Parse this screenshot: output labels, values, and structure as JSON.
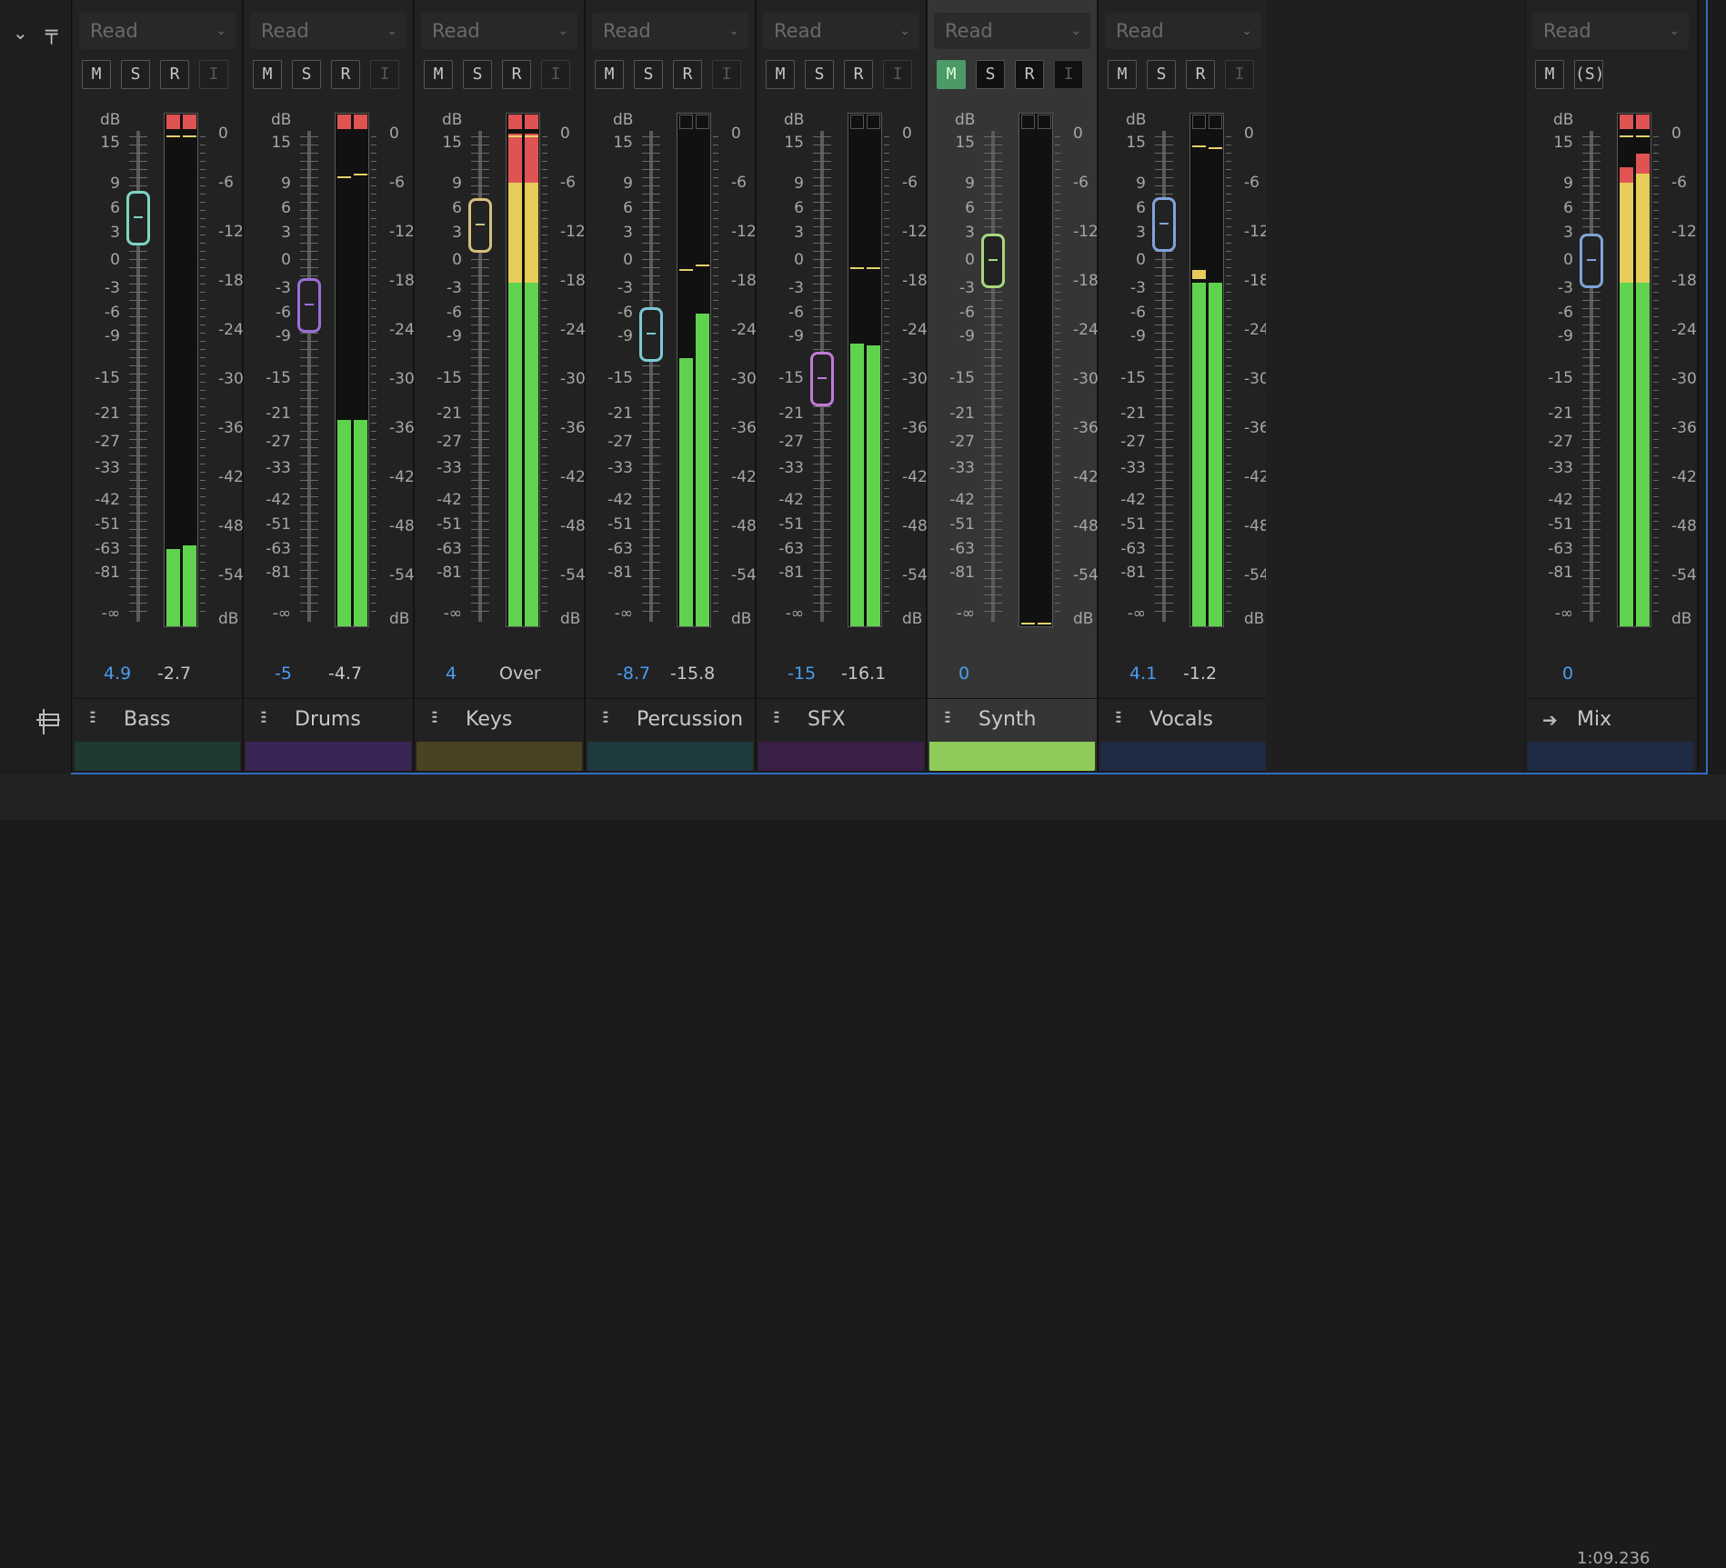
{
  "left_panel": {
    "collapse_icon": "chevron-down-icon",
    "pin_icon": "pin-icon",
    "track_icon": "track-targeting-icon"
  },
  "mode_label": "Read",
  "scale": {
    "fader_top": "dB",
    "fader_ticks": [
      "15",
      "9",
      "6",
      "3",
      "0",
      "-3",
      "-6",
      "-9",
      "-15",
      "-21",
      "-27",
      "-33",
      "-42",
      "-51",
      "-63",
      "-81",
      "-∞"
    ],
    "meter_ticks": [
      "0",
      "-6",
      "-12",
      "-18",
      "-24",
      "-30",
      "-36",
      "-42",
      "-48",
      "-54",
      "dB"
    ]
  },
  "buttons": {
    "mute": "M",
    "solo": "S",
    "record": "R",
    "input": "I",
    "solo_safe": "(S)"
  },
  "channels": [
    {
      "name": "Bass",
      "volume": "4.9",
      "peak": "-2.7",
      "fader_db": 4.9,
      "fader_color": "#7fd3c2",
      "swatch": "#1f3a33",
      "meter_level_db": [
        -50.5,
        -50.1
      ],
      "peak_hold_db": [
        0,
        0
      ],
      "clip": [
        true,
        true
      ],
      "muted": false,
      "active": false
    },
    {
      "name": "Drums",
      "volume": "-5",
      "peak": "-4.7",
      "fader_db": -5,
      "fader_color": "#9b6ed8",
      "swatch": "#3a2556",
      "meter_level_db": [
        -34.8,
        -34.8
      ],
      "peak_hold_db": [
        -5,
        -4.7
      ],
      "clip": [
        true,
        true
      ],
      "muted": false,
      "active": false
    },
    {
      "name": "Keys",
      "volume": "4",
      "peak": "Over",
      "fader_db": 4,
      "fader_color": "#d2c27a",
      "swatch": "#4a4220",
      "meter_level_db": [
        -18,
        -18
      ],
      "peak_hold_db": [
        0,
        0
      ],
      "clip": [
        true,
        true
      ],
      "muted": false,
      "active": false
    },
    {
      "name": "Percussion",
      "volume": "-8.7",
      "peak": "-15.8",
      "fader_db": -8.7,
      "fader_color": "#7ec8d6",
      "swatch": "#1f3a3f",
      "meter_level_db": [
        -27.2,
        -21.8
      ],
      "peak_hold_db": [
        -16.3,
        -15.8
      ],
      "clip": [
        false,
        false
      ],
      "muted": false,
      "active": false
    },
    {
      "name": "SFX",
      "volume": "-15",
      "peak": "-16.1",
      "fader_db": -15,
      "fader_color": "#c07ad6",
      "swatch": "#3a1f46",
      "meter_level_db": [
        -25.4,
        -25.7
      ],
      "peak_hold_db": [
        -16.1,
        -16.1
      ],
      "clip": [
        false,
        false
      ],
      "muted": false,
      "active": false
    },
    {
      "name": "Synth",
      "volume": "0",
      "peak": "",
      "fader_db": 0,
      "fader_color": "#a8d67e",
      "swatch": "#8fcb5a",
      "meter_level_db": [
        -90,
        -90
      ],
      "peak_hold_db": [
        -60,
        -60
      ],
      "clip": [
        false,
        false
      ],
      "muted": true,
      "active": true
    },
    {
      "name": "Vocals",
      "volume": "4.1",
      "peak": "-1.2",
      "fader_db": 4.1,
      "fader_color": "#7fa4d8",
      "swatch": "#1f2a44",
      "meter_level_db": [
        -17.7,
        -18
      ],
      "peak_hold_db": [
        -1.2,
        -1.4
      ],
      "clip": [
        false,
        false
      ],
      "muted": false,
      "active": false
    }
  ],
  "master": {
    "name": "Mix",
    "volume": "0",
    "fader_db": 0,
    "fader_color": "#7fa4d8",
    "swatch": "#1f2a44",
    "meter_level_db": [
      -18,
      -18
    ],
    "time": "1:09.236",
    "clip": [
      true,
      true
    ]
  }
}
